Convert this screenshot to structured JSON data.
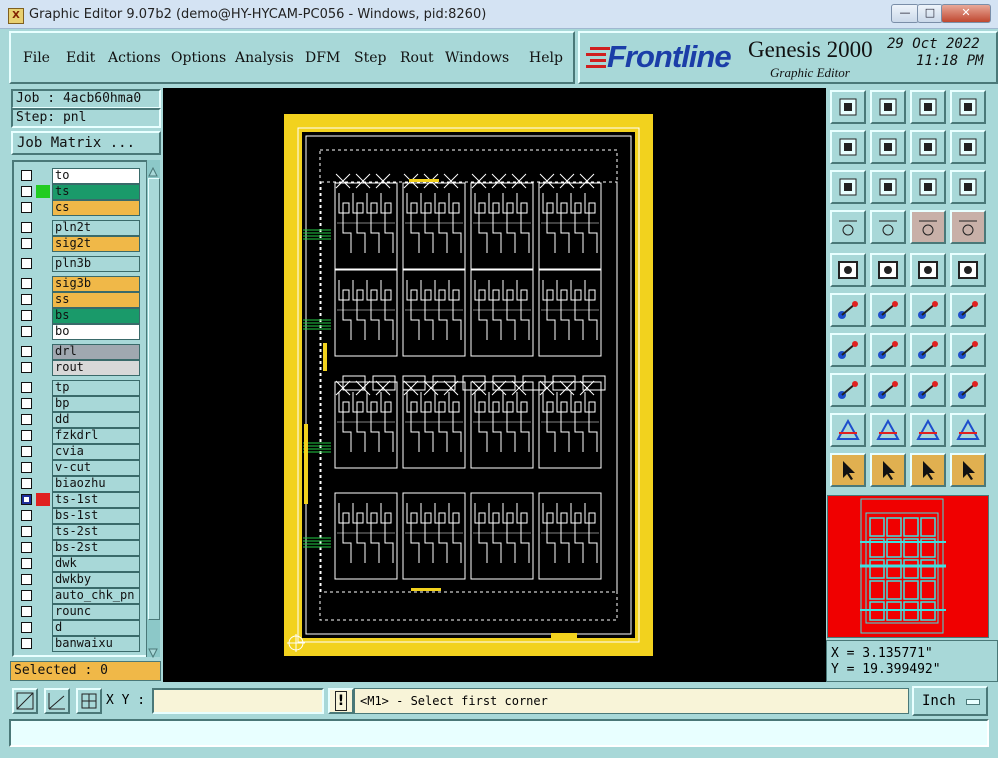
{
  "window": {
    "title": "Graphic Editor 9.07b2 (demo@HY-HYCAM-PC056 - Windows, pid:8260)"
  },
  "menu": {
    "items": [
      "File",
      "Edit",
      "Actions",
      "Options",
      "Analysis",
      "DFM",
      "Step",
      "Rout",
      "Windows",
      "Help"
    ]
  },
  "brand": {
    "logo": "Frontline",
    "product": "Genesis 2000",
    "subtitle": "Graphic Editor",
    "date": "29 Oct 2022",
    "time": "11:18 PM"
  },
  "job": {
    "job": "Job : 4acb60hma0",
    "step": "Step: pnl",
    "matrix_button": "Job Matrix ..."
  },
  "layers": [
    {
      "name": "to",
      "color": "#ffffff",
      "swatch": ""
    },
    {
      "name": "ts",
      "color": "#1a9a6a",
      "swatch": "#22cc22"
    },
    {
      "name": "cs",
      "color": "#f0b848",
      "swatch": ""
    },
    {
      "name": "pln2t",
      "color": "#a8d8d8",
      "swatch": ""
    },
    {
      "name": "sig2t",
      "color": "#f0b848",
      "swatch": ""
    },
    {
      "name": "pln3b",
      "color": "#a8d8d8",
      "swatch": ""
    },
    {
      "name": "sig3b",
      "color": "#f0b848",
      "swatch": ""
    },
    {
      "name": "ss",
      "color": "#f0b848",
      "swatch": ""
    },
    {
      "name": "bs",
      "color": "#1a9a6a",
      "swatch": ""
    },
    {
      "name": "bo",
      "color": "#ffffff",
      "swatch": ""
    },
    {
      "name": "drl",
      "color": "#a0a8b0",
      "swatch": ""
    },
    {
      "name": "rout",
      "color": "#d8d8d8",
      "swatch": ""
    },
    {
      "name": "tp",
      "color": "#a8d8d8",
      "swatch": ""
    },
    {
      "name": "bp",
      "color": "#a8d8d8",
      "swatch": ""
    },
    {
      "name": "dd",
      "color": "#a8d8d8",
      "swatch": ""
    },
    {
      "name": "fzkdrl",
      "color": "#a8d8d8",
      "swatch": ""
    },
    {
      "name": "cvia",
      "color": "#a8d8d8",
      "swatch": ""
    },
    {
      "name": "v-cut",
      "color": "#a8d8d8",
      "swatch": ""
    },
    {
      "name": "biaozhu",
      "color": "#a8d8d8",
      "swatch": ""
    },
    {
      "name": "ts-1st",
      "color": "#a8d8d8",
      "swatch": "#e02020"
    },
    {
      "name": "bs-1st",
      "color": "#a8d8d8",
      "swatch": ""
    },
    {
      "name": "ts-2st",
      "color": "#a8d8d8",
      "swatch": ""
    },
    {
      "name": "bs-2st",
      "color": "#a8d8d8",
      "swatch": ""
    },
    {
      "name": "dwk",
      "color": "#a8d8d8",
      "swatch": ""
    },
    {
      "name": "dwkby",
      "color": "#a8d8d8",
      "swatch": ""
    },
    {
      "name": "auto_chk_pn",
      "color": "#a8d8d8",
      "swatch": ""
    },
    {
      "name": "rounc",
      "color": "#a8d8d8",
      "swatch": ""
    },
    {
      "name": "d",
      "color": "#a8d8d8",
      "swatch": ""
    },
    {
      "name": "banwaixu",
      "color": "#a8d8d8",
      "swatch": ""
    }
  ],
  "selected": "Selected : 0",
  "coords": {
    "x": "X = 3.135771\"",
    "y": "Y = 19.399492\""
  },
  "bottom": {
    "xy_label": "X Y :",
    "xy_value": "",
    "prompt": "<M1> - Select first corner",
    "units": "Inch"
  }
}
